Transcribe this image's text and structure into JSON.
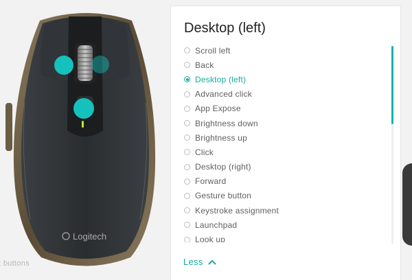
{
  "panel": {
    "title": "Desktop (left)",
    "options": [
      {
        "label": "Scroll left",
        "selected": false
      },
      {
        "label": "Back",
        "selected": false
      },
      {
        "label": "Desktop (left)",
        "selected": true
      },
      {
        "label": "Advanced click",
        "selected": false
      },
      {
        "label": "App Expose",
        "selected": false
      },
      {
        "label": "Brightness down",
        "selected": false
      },
      {
        "label": "Brightness up",
        "selected": false
      },
      {
        "label": "Click",
        "selected": false
      },
      {
        "label": "Desktop (right)",
        "selected": false
      },
      {
        "label": "Forward",
        "selected": false
      },
      {
        "label": "Gesture button",
        "selected": false
      },
      {
        "label": "Keystroke assignment",
        "selected": false
      },
      {
        "label": "Launchpad",
        "selected": false
      },
      {
        "label": "Look up",
        "selected": false
      }
    ],
    "less_label": "Less"
  },
  "mouse": {
    "brand_text": "Logitech",
    "caption": "t buttons"
  },
  "colors": {
    "accent": "#15c1bc",
    "accent_text": "#15a7a2"
  },
  "icons": {
    "less": "chevron-up-icon",
    "selected_radio": "radio-selected-icon"
  }
}
